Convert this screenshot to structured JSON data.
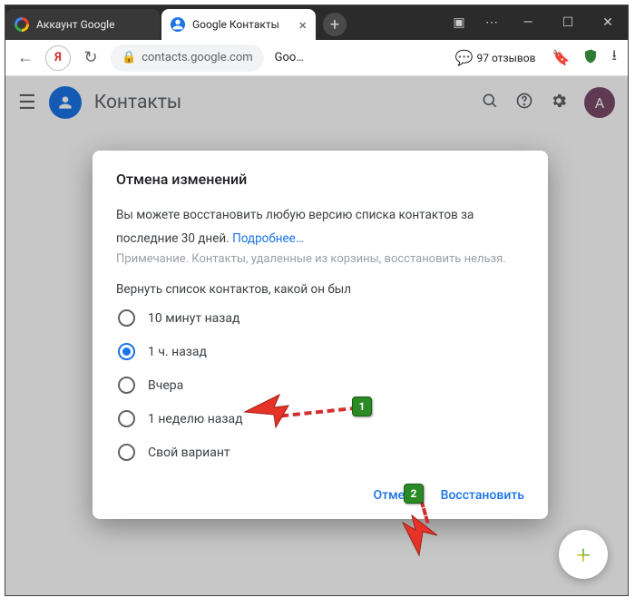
{
  "browser": {
    "tabs": [
      {
        "title": "Аккаунт Google",
        "active": false
      },
      {
        "title": "Google Контакты",
        "active": true
      }
    ],
    "url_display": "contacts.google.com",
    "url_truncated": "Goo…",
    "reviews_count": "97 отзывов"
  },
  "app": {
    "title": "Контакты",
    "avatar_letter": "A"
  },
  "dialog": {
    "title": "Отмена изменений",
    "body_line1": "Вы можете восстановить любую версию списка контактов за",
    "body_line2_prefix": "последние 30 дней. ",
    "learn_more": "Подробнее…",
    "note": "Примечание. Контакты, удаленные из корзины, восстановить нельзя.",
    "subheader": "Вернуть список контактов, какой он был",
    "options": {
      "o0": "10 минут назад",
      "o1": "1 ч. назад",
      "o2": "Вчера",
      "o3": "1 неделю назад",
      "o4": "Свой вариант"
    },
    "selected_index": 1,
    "cancel": "Отмена",
    "confirm": "Восстановить"
  },
  "annotations": {
    "b1": "1",
    "b2": "2"
  }
}
